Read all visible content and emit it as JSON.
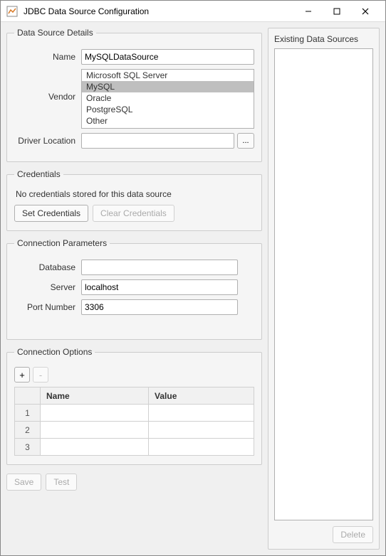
{
  "window": {
    "title": "JDBC Data Source Configuration"
  },
  "details": {
    "legend": "Data Source Details",
    "name_label": "Name",
    "name_value": "MySQLDataSource",
    "vendor_label": "Vendor",
    "vendors": {
      "0": "Microsoft SQL Server",
      "1": "MySQL",
      "2": "Oracle",
      "3": "PostgreSQL",
      "4": "Other"
    },
    "vendor_selected": "MySQL",
    "driver_label": "Driver Location",
    "driver_value": "",
    "browse_label": "..."
  },
  "credentials": {
    "legend": "Credentials",
    "message": "No credentials stored for this data source",
    "set_label": "Set Credentials",
    "clear_label": "Clear Credentials"
  },
  "conn": {
    "legend": "Connection Parameters",
    "database_label": "Database",
    "database_value": "",
    "server_label": "Server",
    "server_value": "localhost",
    "port_label": "Port Number",
    "port_value": "3306"
  },
  "options": {
    "legend": "Connection Options",
    "add_label": "+",
    "remove_label": "-",
    "headers": {
      "name": "Name",
      "value": "Value"
    },
    "rows": {
      "0": {
        "num": "1"
      },
      "1": {
        "num": "2"
      },
      "2": {
        "num": "3"
      }
    }
  },
  "footer": {
    "save": "Save",
    "test": "Test"
  },
  "existing": {
    "title": "Existing Data Sources",
    "delete": "Delete"
  }
}
